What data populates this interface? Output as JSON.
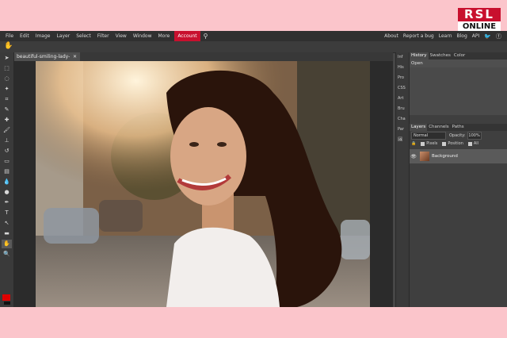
{
  "logo": {
    "line1": "RSL",
    "line2": "ONLINE"
  },
  "menu": {
    "items": [
      "File",
      "Edit",
      "Image",
      "Layer",
      "Select",
      "Filter",
      "View",
      "Window",
      "More"
    ],
    "account": "Account",
    "right": [
      "About",
      "Report a bug",
      "Learn",
      "Blog",
      "API"
    ]
  },
  "document": {
    "tab_title": "beautiful-smiling-lady-",
    "close_glyph": "✕"
  },
  "side_strip": [
    "Inf",
    "His",
    "Pro",
    "CSS",
    "Art",
    "Bru",
    "Cha",
    "Par"
  ],
  "history_panel": {
    "tabs": [
      "History",
      "Swatches",
      "Color"
    ],
    "items": [
      "Open"
    ]
  },
  "layers_panel": {
    "tabs": [
      "Layers",
      "Channels",
      "Paths"
    ],
    "blend_mode": "Normal",
    "opacity_label": "Opacity:",
    "opacity_value": "100%",
    "lock_options": [
      "Pixels",
      "Position",
      "All"
    ],
    "layers": [
      {
        "name": "Background"
      }
    ]
  },
  "colors": {
    "accent": "#c8102e",
    "foreground": "#e00000",
    "background": "#111111"
  }
}
